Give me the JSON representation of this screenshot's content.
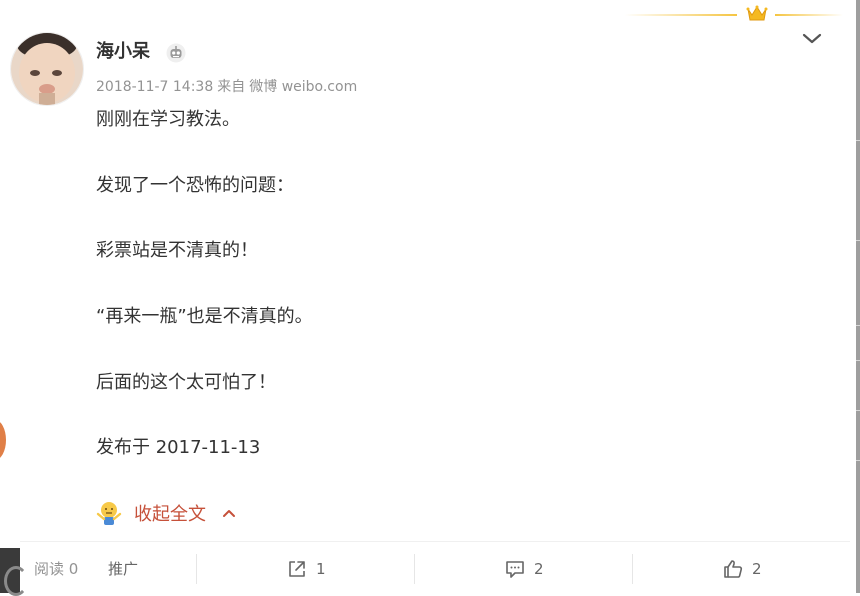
{
  "post": {
    "username": "海小呆",
    "time": "2018-11-7 14:38",
    "source_prefix": "来自",
    "source": "微博 weibo.com",
    "lines": [
      "刚刚在学习教法。",
      "发现了一个恐怖的问题：",
      "彩票站是不清真的！",
      "“再来一瓶”也是不清真的。",
      "后面的这个太可怕了！",
      "发布于 2017-11-13"
    ],
    "collapse_label": "收起全文"
  },
  "footer": {
    "read_label": "阅读 0",
    "promote_label": "推广",
    "share_count": "1",
    "comment_count": "2",
    "like_count": "2"
  },
  "colors": {
    "accent": "#c6513a",
    "meta_gray": "#939393",
    "crown_gold": "#f5c542"
  },
  "icons": [
    "robot-icon",
    "chevron-down-icon",
    "crown-icon",
    "shrug-emoji-icon",
    "chevron-up-icon",
    "share-icon",
    "comment-icon",
    "like-icon"
  ]
}
